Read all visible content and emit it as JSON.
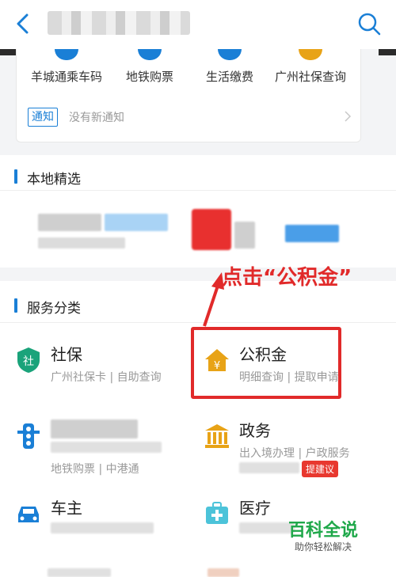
{
  "header": {
    "back_icon": "chevron-left-icon",
    "search_icon": "search-icon"
  },
  "quick_services": [
    {
      "label": "羊城通乘车码",
      "icon": "qrcode-icon",
      "color": "#1a7fd6"
    },
    {
      "label": "地铁购票",
      "icon": "metro-icon",
      "color": "#1a7fd6"
    },
    {
      "label": "生活缴费",
      "icon": "lightning-icon",
      "color": "#1a7fd6"
    },
    {
      "label": "广州社保查询",
      "icon": "shield-icon",
      "color": "#e8a317"
    }
  ],
  "notice": {
    "tag": "通知",
    "text": "没有新通知"
  },
  "local_picks": {
    "title": "本地精选"
  },
  "service_categories": {
    "title": "服务分类",
    "items": [
      {
        "title": "社保",
        "subtitle": "广州社保卡 | 自助查询",
        "icon": "shield-icon",
        "color": "#1aa37a"
      },
      {
        "title": "公积金",
        "subtitle": "明细查询 | 提取申请",
        "icon": "house-yen-icon",
        "color": "#e8a317"
      },
      {
        "title": "",
        "subtitle": "地铁购票 | 中港通",
        "icon": "traffic-light-icon",
        "color": "#1a7fd6"
      },
      {
        "title": "政务",
        "subtitle": "出入境办理 | 户政服务",
        "icon": "government-icon",
        "color": "#e8a317"
      },
      {
        "title": "车主",
        "subtitle": "",
        "icon": "car-icon",
        "color": "#1a7fd6"
      },
      {
        "title": "医疗",
        "subtitle": "",
        "icon": "medical-icon",
        "color": "#4cc3d9"
      }
    ]
  },
  "suggest_badge": "提建议",
  "annotation": "点击“公积金”",
  "watermark": {
    "title": "百科全说",
    "subtitle": "助你轻松解决"
  },
  "colors": {
    "accent": "#1a7fd6",
    "highlight": "#e12a2a"
  }
}
